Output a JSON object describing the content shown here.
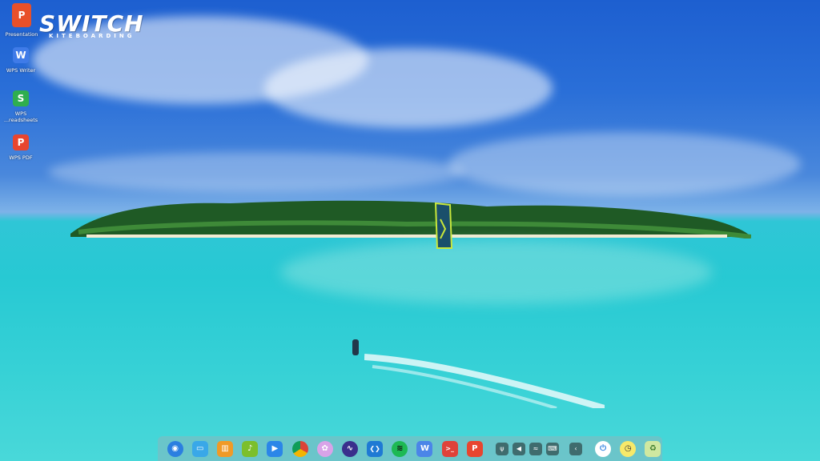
{
  "wallpaper": {
    "logo_text": "SWITCH",
    "logo_subtext": "KITEBOARDING",
    "sky_color": "#2a6fd8",
    "water_color": "#2fc6d6"
  },
  "desktop_icons": [
    {
      "label": "Presentation",
      "icon": "wps-presentation-icon",
      "letter": "P",
      "color": "#e8502a"
    },
    {
      "label": "WPS Writer",
      "icon": "wps-writer-icon",
      "letter": "W",
      "color": "#3f7be8"
    },
    {
      "label": "WPS\n...readsheets",
      "icon": "wps-spreadsheets-icon",
      "letter": "S",
      "color": "#2fae4f"
    },
    {
      "label": "WPS PDF",
      "icon": "wps-pdf-icon",
      "letter": "P",
      "color": "#e8452f"
    }
  ],
  "dock": {
    "apps": [
      {
        "icon": "launcher-icon",
        "glyph": "◉",
        "color": "#2b7fe0"
      },
      {
        "icon": "file-manager-icon",
        "glyph": "▭",
        "color": "#39a8e8"
      },
      {
        "icon": "app-store-icon",
        "glyph": "▥",
        "color": "#f09a27"
      },
      {
        "icon": "music-icon",
        "glyph": "♪",
        "color": "#7cbf2c"
      },
      {
        "icon": "video-icon",
        "glyph": "▶",
        "color": "#2b86e8"
      },
      {
        "icon": "chrome-icon",
        "glyph": "●",
        "color": "#db4437"
      },
      {
        "icon": "settings-icon",
        "glyph": "✿",
        "color": "#d9a3e8"
      },
      {
        "icon": "system-monitor-icon",
        "glyph": "∿",
        "color": "#3a2f8c"
      },
      {
        "icon": "vscode-icon",
        "glyph": "❮❯",
        "color": "#1f7ad4"
      },
      {
        "icon": "spotify-icon",
        "glyph": "≋",
        "color": "#1db954"
      },
      {
        "icon": "wps-writer-icon",
        "glyph": "W",
        "color": "#4b85e8"
      },
      {
        "icon": "terminal-icon",
        "glyph": ">_",
        "color": "#e0423a"
      },
      {
        "icon": "wps-pdf-icon",
        "glyph": "P",
        "color": "#e8452f"
      }
    ],
    "tray": [
      {
        "icon": "usb-icon",
        "glyph": "ψ"
      },
      {
        "icon": "volume-icon",
        "glyph": "◀"
      },
      {
        "icon": "wifi-icon",
        "glyph": "≈"
      },
      {
        "icon": "keyboard-icon",
        "glyph": "⌨"
      },
      {
        "icon": "chevron-left-icon",
        "glyph": "‹"
      }
    ],
    "system": [
      {
        "icon": "power-icon",
        "glyph": "⏻",
        "color": "#ffffff"
      },
      {
        "icon": "clock-icon",
        "glyph": "◷",
        "color": "#f7e96a"
      },
      {
        "icon": "trash-icon",
        "glyph": "♻",
        "color": "#cfe8a0"
      }
    ]
  }
}
